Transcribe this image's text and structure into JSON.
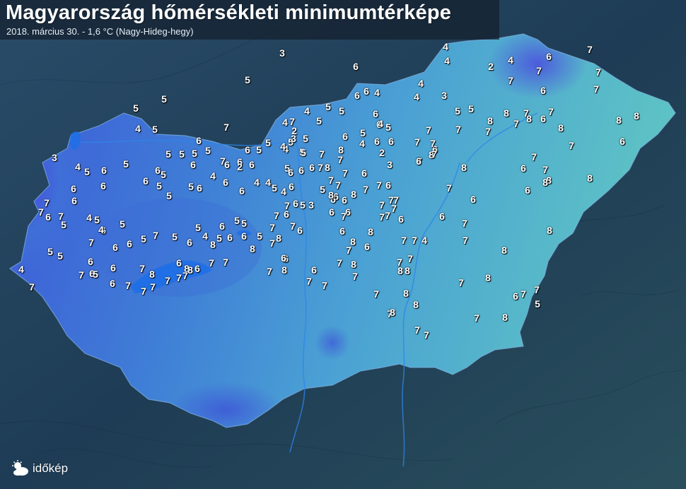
{
  "header": {
    "title": "Magyarország hőmérsékleti minimumtérképe",
    "subtitle": "2018. március 30. - 1,6 °C (Nagy-Hideg-hegy)"
  },
  "brand": {
    "name": "időkép"
  },
  "colors": {
    "cold": "#3a3fd0",
    "mid": "#3d8fd8",
    "warm": "#5fc0c8",
    "terrain": "#24455e",
    "river": "#2a7fe0"
  },
  "stations": [
    {
      "v": "3"
    },
    {
      "v": "5"
    },
    {
      "v": "6"
    },
    {
      "v": "7"
    },
    {
      "v": "5"
    },
    {
      "v": "5"
    },
    {
      "v": "7"
    },
    {
      "v": "5"
    },
    {
      "v": "4"
    },
    {
      "v": "5"
    },
    {
      "v": "4"
    },
    {
      "v": "4"
    },
    {
      "v": "4"
    },
    {
      "v": "2"
    },
    {
      "v": "4"
    },
    {
      "v": "6"
    },
    {
      "v": "7"
    },
    {
      "v": "7"
    },
    {
      "v": "7"
    },
    {
      "v": "7"
    },
    {
      "v": "6"
    },
    {
      "v": "5"
    },
    {
      "v": "5"
    },
    {
      "v": "6"
    },
    {
      "v": "6"
    },
    {
      "v": "4"
    },
    {
      "v": "4"
    },
    {
      "v": "4"
    },
    {
      "v": "3"
    },
    {
      "v": "5"
    },
    {
      "v": "5"
    },
    {
      "v": "6"
    },
    {
      "v": "6"
    },
    {
      "v": "6"
    },
    {
      "v": "5"
    },
    {
      "v": "6"
    },
    {
      "v": "4"
    },
    {
      "v": "7"
    },
    {
      "v": "4"
    },
    {
      "v": "5"
    },
    {
      "v": "5"
    },
    {
      "v": "4"
    },
    {
      "v": "5"
    },
    {
      "v": "6"
    },
    {
      "v": "5"
    },
    {
      "v": "5"
    },
    {
      "v": "6"
    },
    {
      "v": "6"
    },
    {
      "v": "2"
    },
    {
      "v": "3"
    },
    {
      "v": "4"
    },
    {
      "v": "5"
    },
    {
      "v": "6"
    },
    {
      "v": "5"
    },
    {
      "v": "5"
    },
    {
      "v": "5"
    },
    {
      "v": "5"
    },
    {
      "v": "6"
    },
    {
      "v": "7"
    },
    {
      "v": "6"
    },
    {
      "v": "6"
    },
    {
      "v": "5"
    },
    {
      "v": "6"
    },
    {
      "v": "7"
    },
    {
      "v": "7"
    },
    {
      "v": "8"
    },
    {
      "v": "8"
    },
    {
      "v": "4"
    },
    {
      "v": "2"
    },
    {
      "v": "3"
    },
    {
      "v": "3"
    },
    {
      "v": "4"
    },
    {
      "v": "5"
    },
    {
      "v": "6"
    },
    {
      "v": "6"
    },
    {
      "v": "5"
    },
    {
      "v": "6"
    },
    {
      "v": "5"
    },
    {
      "v": "6"
    },
    {
      "v": "5"
    },
    {
      "v": "5"
    },
    {
      "v": "5"
    },
    {
      "v": "6"
    },
    {
      "v": "4"
    },
    {
      "v": "6"
    },
    {
      "v": "2"
    },
    {
      "v": "4"
    },
    {
      "v": "6"
    },
    {
      "v": "4"
    },
    {
      "v": "5"
    },
    {
      "v": "4"
    },
    {
      "v": "5"
    },
    {
      "v": "6"
    },
    {
      "v": "6"
    },
    {
      "v": "6"
    },
    {
      "v": "7"
    },
    {
      "v": "7"
    },
    {
      "v": "7"
    },
    {
      "v": "6"
    },
    {
      "v": "7"
    },
    {
      "v": "6"
    },
    {
      "v": "7"
    },
    {
      "v": "8"
    },
    {
      "v": "7"
    },
    {
      "v": "5"
    },
    {
      "v": "3"
    },
    {
      "v": "6"
    },
    {
      "v": "6"
    },
    {
      "v": "6"
    },
    {
      "v": "7"
    },
    {
      "v": "6"
    },
    {
      "v": "6"
    },
    {
      "v": "5"
    },
    {
      "v": "6"
    },
    {
      "v": "6"
    },
    {
      "v": "7"
    },
    {
      "v": "7"
    },
    {
      "v": "7"
    },
    {
      "v": "7"
    },
    {
      "v": "7"
    },
    {
      "v": "7"
    },
    {
      "v": "6"
    },
    {
      "v": "7"
    },
    {
      "v": "6"
    },
    {
      "v": "6"
    },
    {
      "v": "8"
    },
    {
      "v": "7"
    },
    {
      "v": "7"
    },
    {
      "v": "7"
    },
    {
      "v": "7"
    },
    {
      "v": "7"
    },
    {
      "v": "8"
    },
    {
      "v": "7"
    },
    {
      "v": "8"
    },
    {
      "v": "7"
    },
    {
      "v": "8"
    },
    {
      "v": "7"
    },
    {
      "v": "6"
    },
    {
      "v": "7"
    },
    {
      "v": "8"
    },
    {
      "v": "7"
    },
    {
      "v": "8"
    },
    {
      "v": "6"
    },
    {
      "v": "8"
    },
    {
      "v": "7"
    },
    {
      "v": "6"
    },
    {
      "v": "7"
    },
    {
      "v": "8"
    },
    {
      "v": "8"
    },
    {
      "v": "8"
    },
    {
      "v": "6"
    },
    {
      "v": "7"
    },
    {
      "v": "8"
    },
    {
      "v": "6"
    },
    {
      "v": "6"
    },
    {
      "v": "7"
    },
    {
      "v": "8"
    },
    {
      "v": "8"
    },
    {
      "v": "7"
    },
    {
      "v": "4"
    },
    {
      "v": "7"
    },
    {
      "v": "7"
    },
    {
      "v": "8"
    },
    {
      "v": "6"
    },
    {
      "v": "8"
    },
    {
      "v": "7"
    },
    {
      "v": "6"
    },
    {
      "v": "7"
    },
    {
      "v": "8"
    },
    {
      "v": "6"
    },
    {
      "v": "7"
    },
    {
      "v": "7"
    },
    {
      "v": "7"
    },
    {
      "v": "8"
    },
    {
      "v": "6"
    },
    {
      "v": "8"
    },
    {
      "v": "7"
    },
    {
      "v": "5"
    },
    {
      "v": "5"
    },
    {
      "v": "5"
    },
    {
      "v": "6"
    },
    {
      "v": "6"
    },
    {
      "v": "6"
    },
    {
      "v": "5"
    },
    {
      "v": "4"
    },
    {
      "v": "5"
    },
    {
      "v": "6"
    },
    {
      "v": "5"
    },
    {
      "v": "7"
    },
    {
      "v": "5"
    },
    {
      "v": "6"
    },
    {
      "v": "6"
    },
    {
      "v": "7"
    },
    {
      "v": "6"
    },
    {
      "v": "5"
    },
    {
      "v": "5"
    },
    {
      "v": "4"
    },
    {
      "v": "4"
    },
    {
      "v": "5"
    },
    {
      "v": "7"
    },
    {
      "v": "6"
    },
    {
      "v": "7"
    },
    {
      "v": "6"
    },
    {
      "v": "6"
    },
    {
      "v": "7"
    },
    {
      "v": "4"
    },
    {
      "v": "7"
    },
    {
      "v": "5"
    },
    {
      "v": "5"
    },
    {
      "v": "6"
    },
    {
      "v": "6"
    },
    {
      "v": "7"
    },
    {
      "v": "5"
    },
    {
      "v": "6"
    },
    {
      "v": "6"
    },
    {
      "v": "7"
    },
    {
      "v": "7"
    },
    {
      "v": "8"
    },
    {
      "v": "7"
    },
    {
      "v": "7"
    },
    {
      "v": "7"
    },
    {
      "v": "7"
    },
    {
      "v": "6"
    },
    {
      "v": "8"
    },
    {
      "v": "7"
    },
    {
      "v": "8"
    },
    {
      "v": "6"
    },
    {
      "v": "7"
    },
    {
      "v": "7"
    },
    {
      "v": "8"
    },
    {
      "v": "7"
    },
    {
      "v": "6"
    },
    {
      "v": "8"
    },
    {
      "v": "6"
    },
    {
      "v": "7"
    },
    {
      "v": "7"
    },
    {
      "v": "7"
    },
    {
      "v": "8"
    },
    {
      "v": "7"
    },
    {
      "v": "7"
    },
    {
      "v": "7"
    },
    {
      "v": "8"
    },
    {
      "v": "7"
    },
    {
      "v": "8"
    },
    {
      "v": "8"
    },
    {
      "v": "8"
    },
    {
      "v": "7"
    },
    {
      "v": "8"
    },
    {
      "v": "6"
    },
    {
      "v": "7"
    },
    {
      "v": "7"
    },
    {
      "v": "5"
    },
    {
      "v": "8"
    },
    {
      "v": "7"
    },
    {
      "v": "7"
    },
    {
      "v": "7"
    },
    {
      "v": "7"
    },
    {
      "v": "8"
    }
  ]
}
